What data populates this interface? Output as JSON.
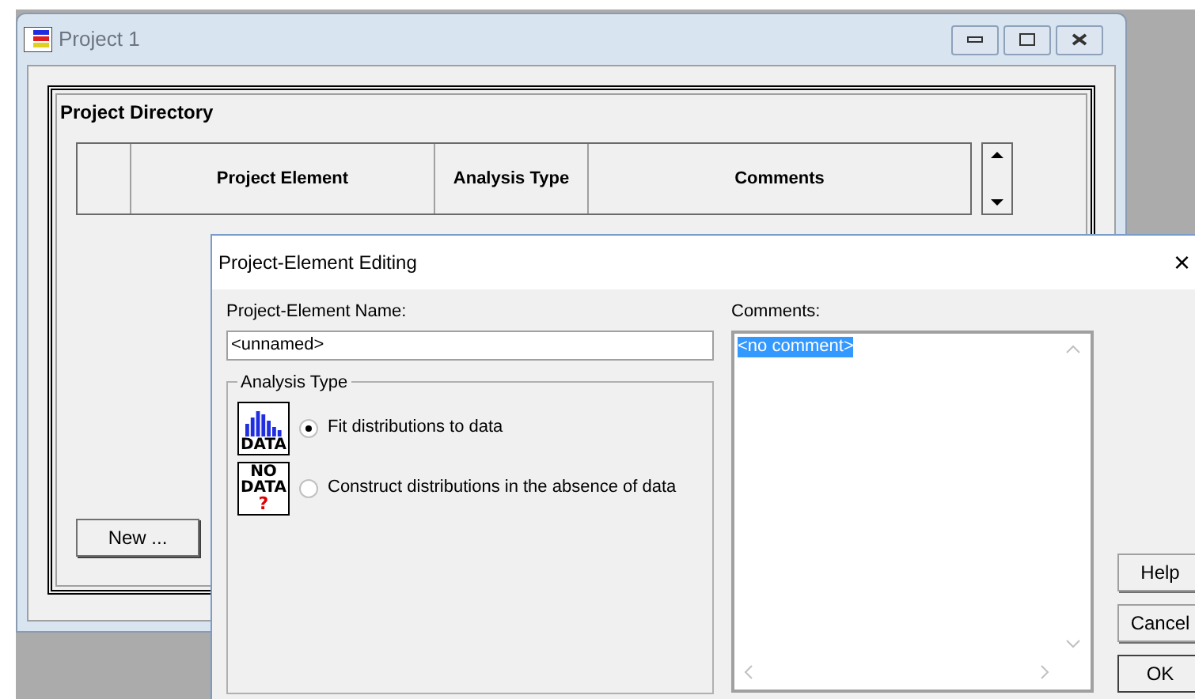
{
  "main_window": {
    "title": "Project 1"
  },
  "project_directory": {
    "title": "Project Directory",
    "columns": [
      "Project Element",
      "Analysis Type",
      "Comments"
    ],
    "new_button": "New ..."
  },
  "dialog": {
    "title": "Project-Element Editing",
    "close": "×",
    "name_label": "Project-Element Name:",
    "name_value": "<unnamed>",
    "analysis_type": {
      "title": "Analysis Type",
      "options": [
        {
          "label": "Fit distributions to data",
          "selected": true,
          "kind": "data",
          "icon_lines": [
            "DATA"
          ]
        },
        {
          "label": "Construct distributions in the absence of data",
          "selected": false,
          "kind": "nodata",
          "icon_lines": [
            "NO",
            "DATA",
            "?"
          ]
        }
      ]
    },
    "comments_label": "Comments:",
    "comments_value": "<no comment>",
    "buttons": [
      "Help",
      "Cancel",
      "OK"
    ]
  }
}
